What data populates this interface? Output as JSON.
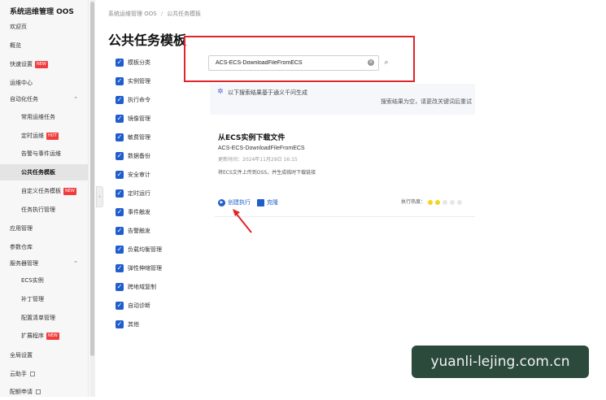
{
  "sidebar": {
    "title": "系统运维管理 OOS",
    "items": [
      {
        "label": "欢迎页"
      },
      {
        "label": "概览"
      },
      {
        "label": "快速设置",
        "badge": "NEW"
      },
      {
        "label": "运维中心"
      },
      {
        "label": "自动化任务",
        "chevron": "⌃"
      },
      {
        "label": "常用运维任务"
      },
      {
        "label": "定时运维",
        "badge": "HOT"
      },
      {
        "label": "告警与事件运维"
      },
      {
        "label": "公共任务模板"
      },
      {
        "label": "自定义任务模板",
        "badge": "NEW"
      },
      {
        "label": "任务执行管理"
      },
      {
        "label": "应用管理"
      },
      {
        "label": "参数仓库"
      },
      {
        "label": "服务器管理",
        "chevron": "⌃"
      },
      {
        "label": "ECS实例"
      },
      {
        "label": "补丁管理"
      },
      {
        "label": "配置清单管理"
      },
      {
        "label": "扩展程序",
        "badge": "NEW"
      },
      {
        "label": "全局设置"
      },
      {
        "label": "云助手"
      },
      {
        "label": "配额申请"
      }
    ]
  },
  "breadcrumb": {
    "root": "系统运维管理 OOS",
    "separator": "/",
    "current": "公共任务模板"
  },
  "page_title": "公共任务模板",
  "filters": [
    "模板分类",
    "实例管理",
    "执行命令",
    "镜像管理",
    "敏费管理",
    "数据备份",
    "安全审计",
    "定时运行",
    "事件触发",
    "告警触发",
    "负载均衡管理",
    "弹性伸缩管理",
    "跨地域复制",
    "自动诊断",
    "其他"
  ],
  "search": {
    "value": "ACS-ECS-DownloadFileFromECS",
    "clear_icon": "×",
    "search_icon": "⌕"
  },
  "ai_panel": {
    "text": "以下搜索结果基于通义千问生成",
    "empty_text": "搜索结果为空，请更改关键词后重试"
  },
  "card": {
    "title": "从ECS实例下载文件",
    "name": "ACS-ECS-DownloadFileFromECS",
    "updated": "更新时间：2024年11月29日 16:15",
    "description": "将ECS文件上传到OSS，并生成临时下载链接",
    "create_label": "创建执行",
    "clone_label": "克隆",
    "heat_label": "执行热度：",
    "heat_level": 2,
    "heat_max": 5
  },
  "watermark": "yuanli-lejing.com.cn",
  "colors": {
    "accent": "#1f5ecb",
    "highlight": "#e0242b",
    "hot_badge": "#f23c3c"
  }
}
